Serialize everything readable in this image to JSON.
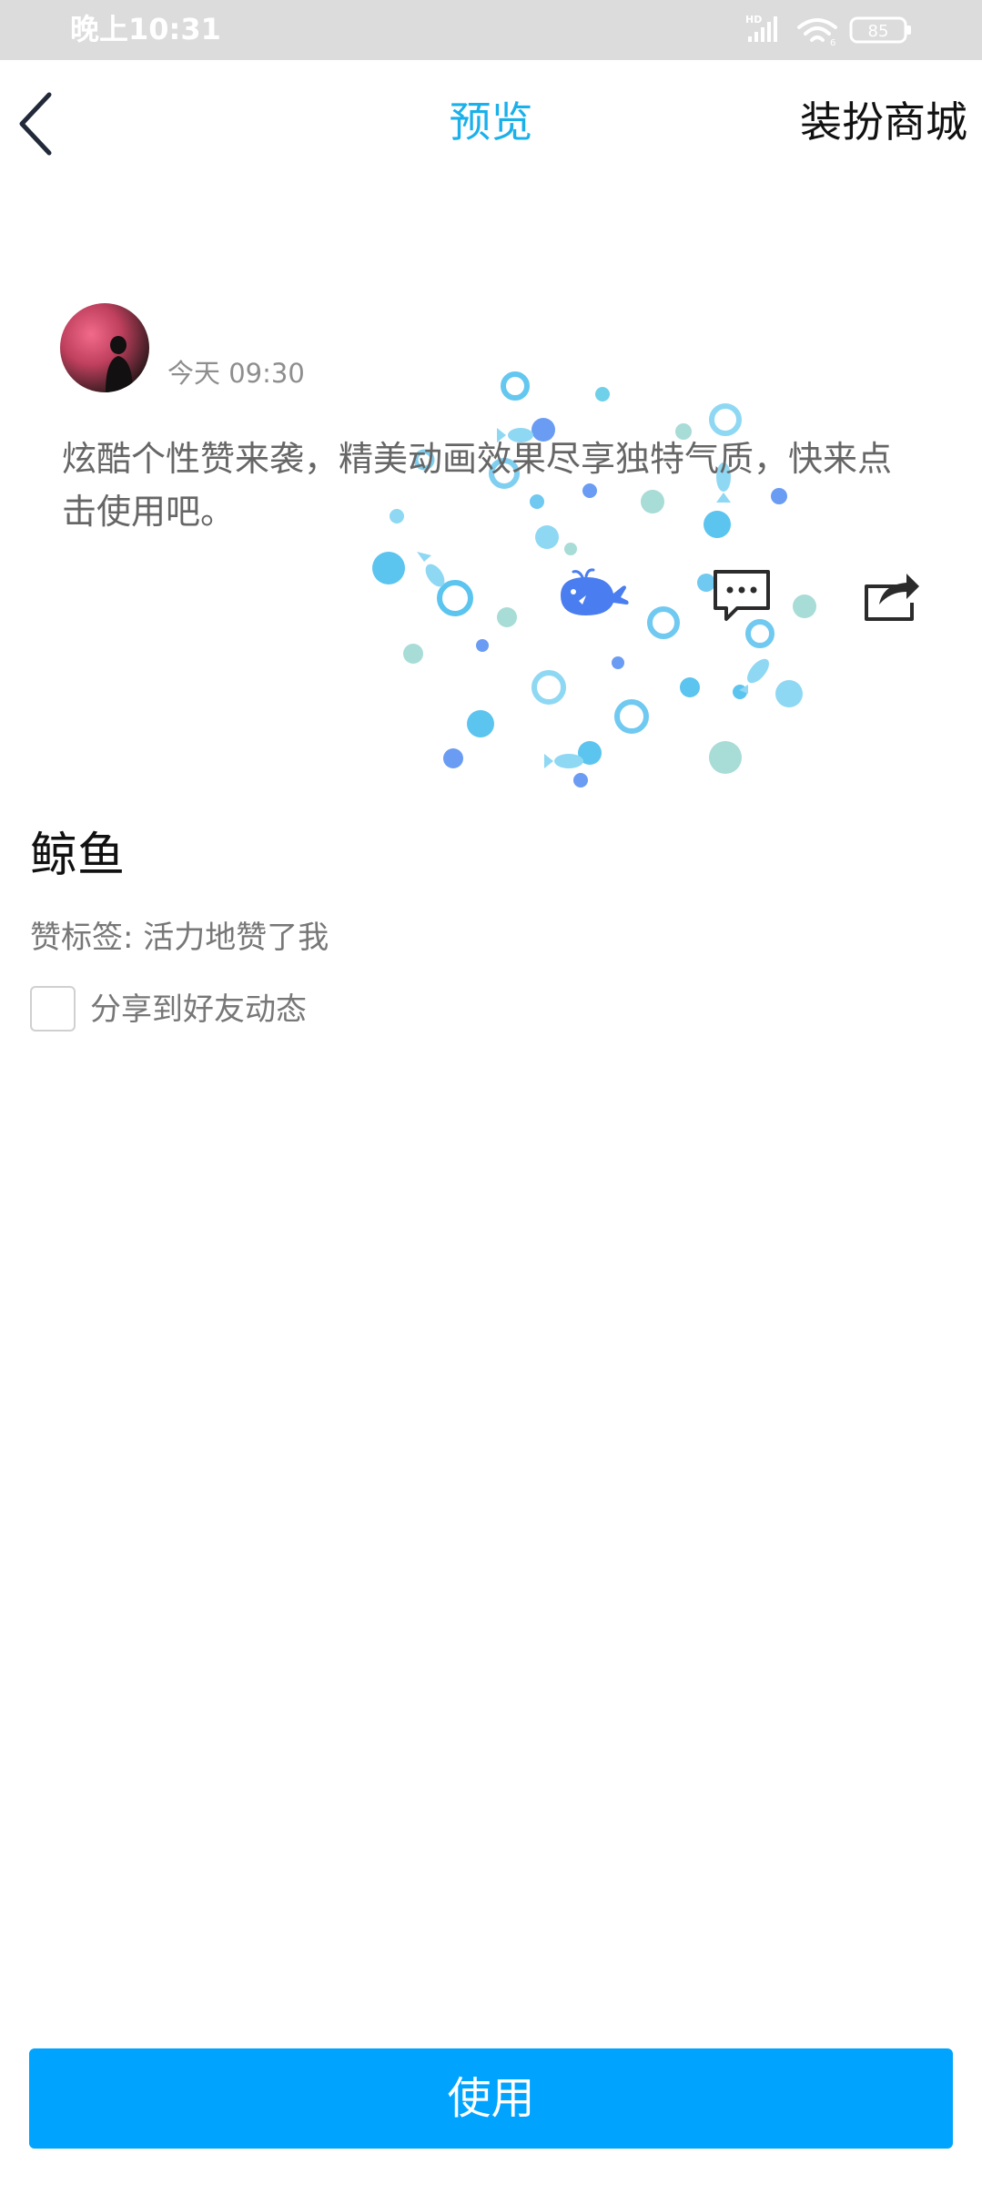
{
  "status_bar": {
    "time": "晚上10:31",
    "network_label": "HD",
    "battery_level": "85"
  },
  "nav": {
    "title": "预览",
    "right_label": "装扮商城"
  },
  "post": {
    "time": "今天 09:30",
    "text": "炫酷个性赞来袭，精美动画效果尽享独特气质，快来点击使用吧。"
  },
  "item": {
    "name": "鲸鱼",
    "tag": "赞标签: 活力地赞了我",
    "share_label": "分享到好友动态",
    "share_checked": false
  },
  "actions": {
    "use_label": "使用"
  },
  "icons": {
    "back": "chevron-left-icon",
    "like": "whale-like-icon",
    "comment": "comment-icon",
    "share": "share-icon"
  },
  "colors": {
    "title_accent": "#1ab0ea",
    "use_button": "#00a4ff",
    "status_bar": "#dcdcdc",
    "like_whale": "#4a7df0"
  }
}
